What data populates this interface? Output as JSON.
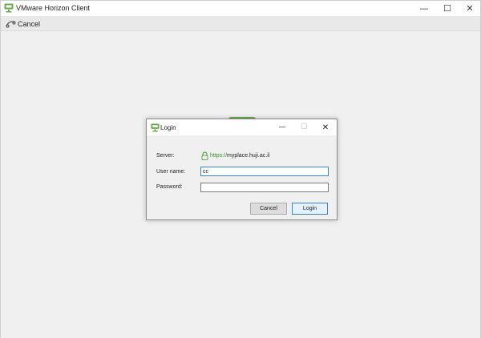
{
  "app": {
    "title": "VMware Horizon Client",
    "window_controls": {
      "minimize": "—",
      "maximize": "☐",
      "close": "✕"
    }
  },
  "toolbar": {
    "cancel_label": "Cancel"
  },
  "colors": {
    "brand_green": "#6aa84f",
    "focus_blue": "#3a84c6",
    "url_green": "#3a8f2a"
  },
  "login_dialog": {
    "title": "Login",
    "window_controls": {
      "minimize": "—",
      "maximize": "☐",
      "close": "✕"
    },
    "server_label": "Server:",
    "server_scheme": "https://",
    "server_host": "myplace.huji.ac.il",
    "username_label": "User name:",
    "username_value": "cc",
    "password_label": "Password:",
    "password_value": "",
    "cancel_label": "Cancel",
    "login_label": "Login",
    "icons": {
      "app_logo": "vmware-horizon-icon",
      "server_security": "lock-icon"
    }
  }
}
